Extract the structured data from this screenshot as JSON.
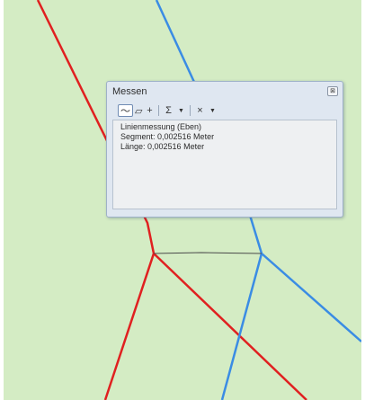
{
  "colors": {
    "map_background": "#d4ecc4",
    "red_line": "#e02020",
    "blue_line": "#3a8ce4",
    "segment_line": "#4a4a4a"
  },
  "dialog": {
    "title": "Messen",
    "close_glyph": "⊠",
    "toolbar": [
      {
        "name": "line-measure-icon",
        "glyph": "〜",
        "active": true
      },
      {
        "name": "area-measure-icon",
        "glyph": "▱",
        "active": false
      },
      {
        "name": "feature-measure-icon",
        "glyph": "+",
        "active": false
      },
      {
        "name": "sum-icon",
        "glyph": "Σ",
        "active": false
      },
      {
        "name": "clear-icon",
        "glyph": "×",
        "active": false
      }
    ],
    "result": {
      "mode": "Linienmessung (Eben)",
      "segment": "Segment: 0,002516 Meter",
      "length": "Länge: 0,002516 Meter"
    }
  }
}
